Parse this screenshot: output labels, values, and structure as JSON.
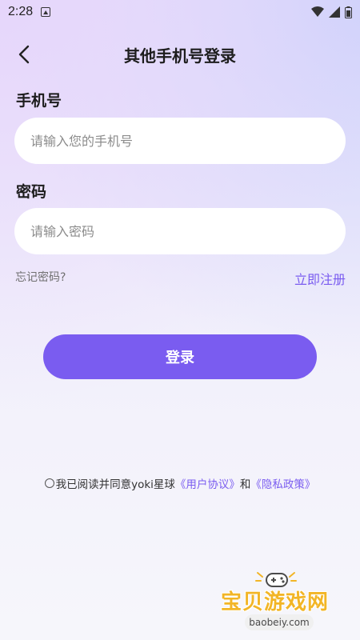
{
  "status_bar": {
    "time": "2:28"
  },
  "header": {
    "title": "其他手机号登录"
  },
  "form": {
    "phone_label": "手机号",
    "phone_placeholder": "请输入您的手机号",
    "phone_value": "",
    "password_label": "密码",
    "password_placeholder": "请输入密码",
    "password_value": ""
  },
  "links": {
    "forgot_password": "忘记密码?",
    "register": "立即注册"
  },
  "login_button": "登录",
  "agreement": {
    "prefix": "我已阅读并同意yoki星球",
    "user_agreement": "《用户协议》",
    "and": "和",
    "privacy_policy": "《隐私政策》",
    "checked": false
  },
  "watermark": {
    "title": "宝贝游戏网",
    "url": "baobeiy.com"
  },
  "colors": {
    "accent": "#7a5cf0",
    "background": "#f1effb"
  }
}
